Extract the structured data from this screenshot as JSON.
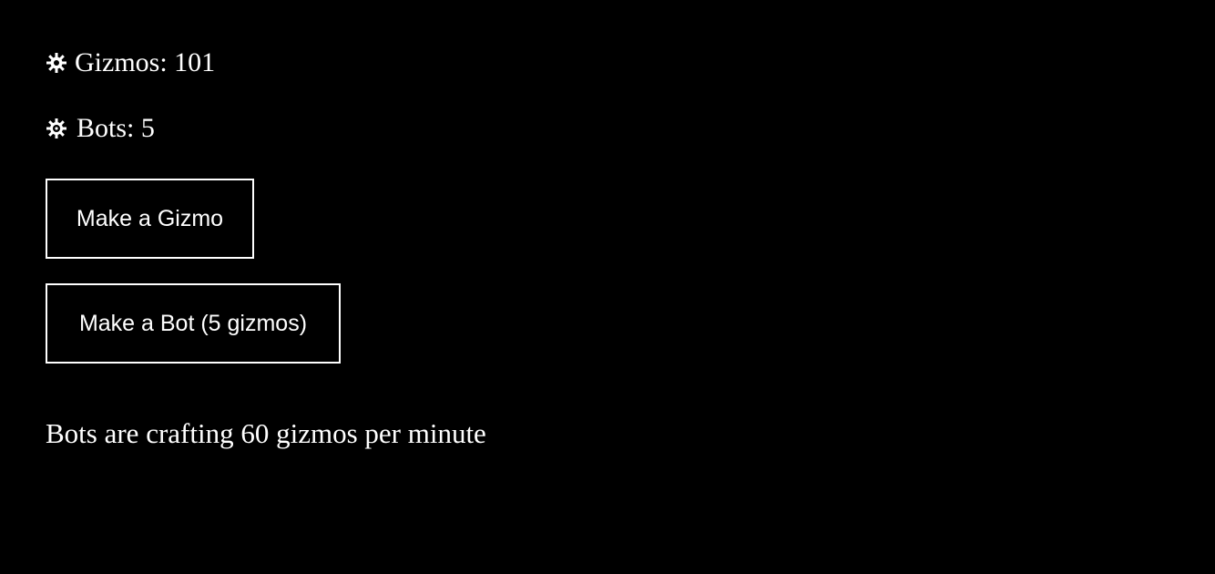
{
  "stats": {
    "gizmos_label": "Gizmos: 101",
    "gizmos_icon": "gear-icon",
    "bots_label": "Bots: 5",
    "bots_icon": "bot-gear-icon"
  },
  "actions": {
    "make_gizmo_label": "Make a Gizmo",
    "make_bot_label": "Make a Bot (5 gizmos)"
  },
  "status": {
    "production_rate_text": "Bots are crafting 60 gizmos per minute"
  },
  "colors": {
    "background": "#000000",
    "foreground": "#ffffff"
  }
}
